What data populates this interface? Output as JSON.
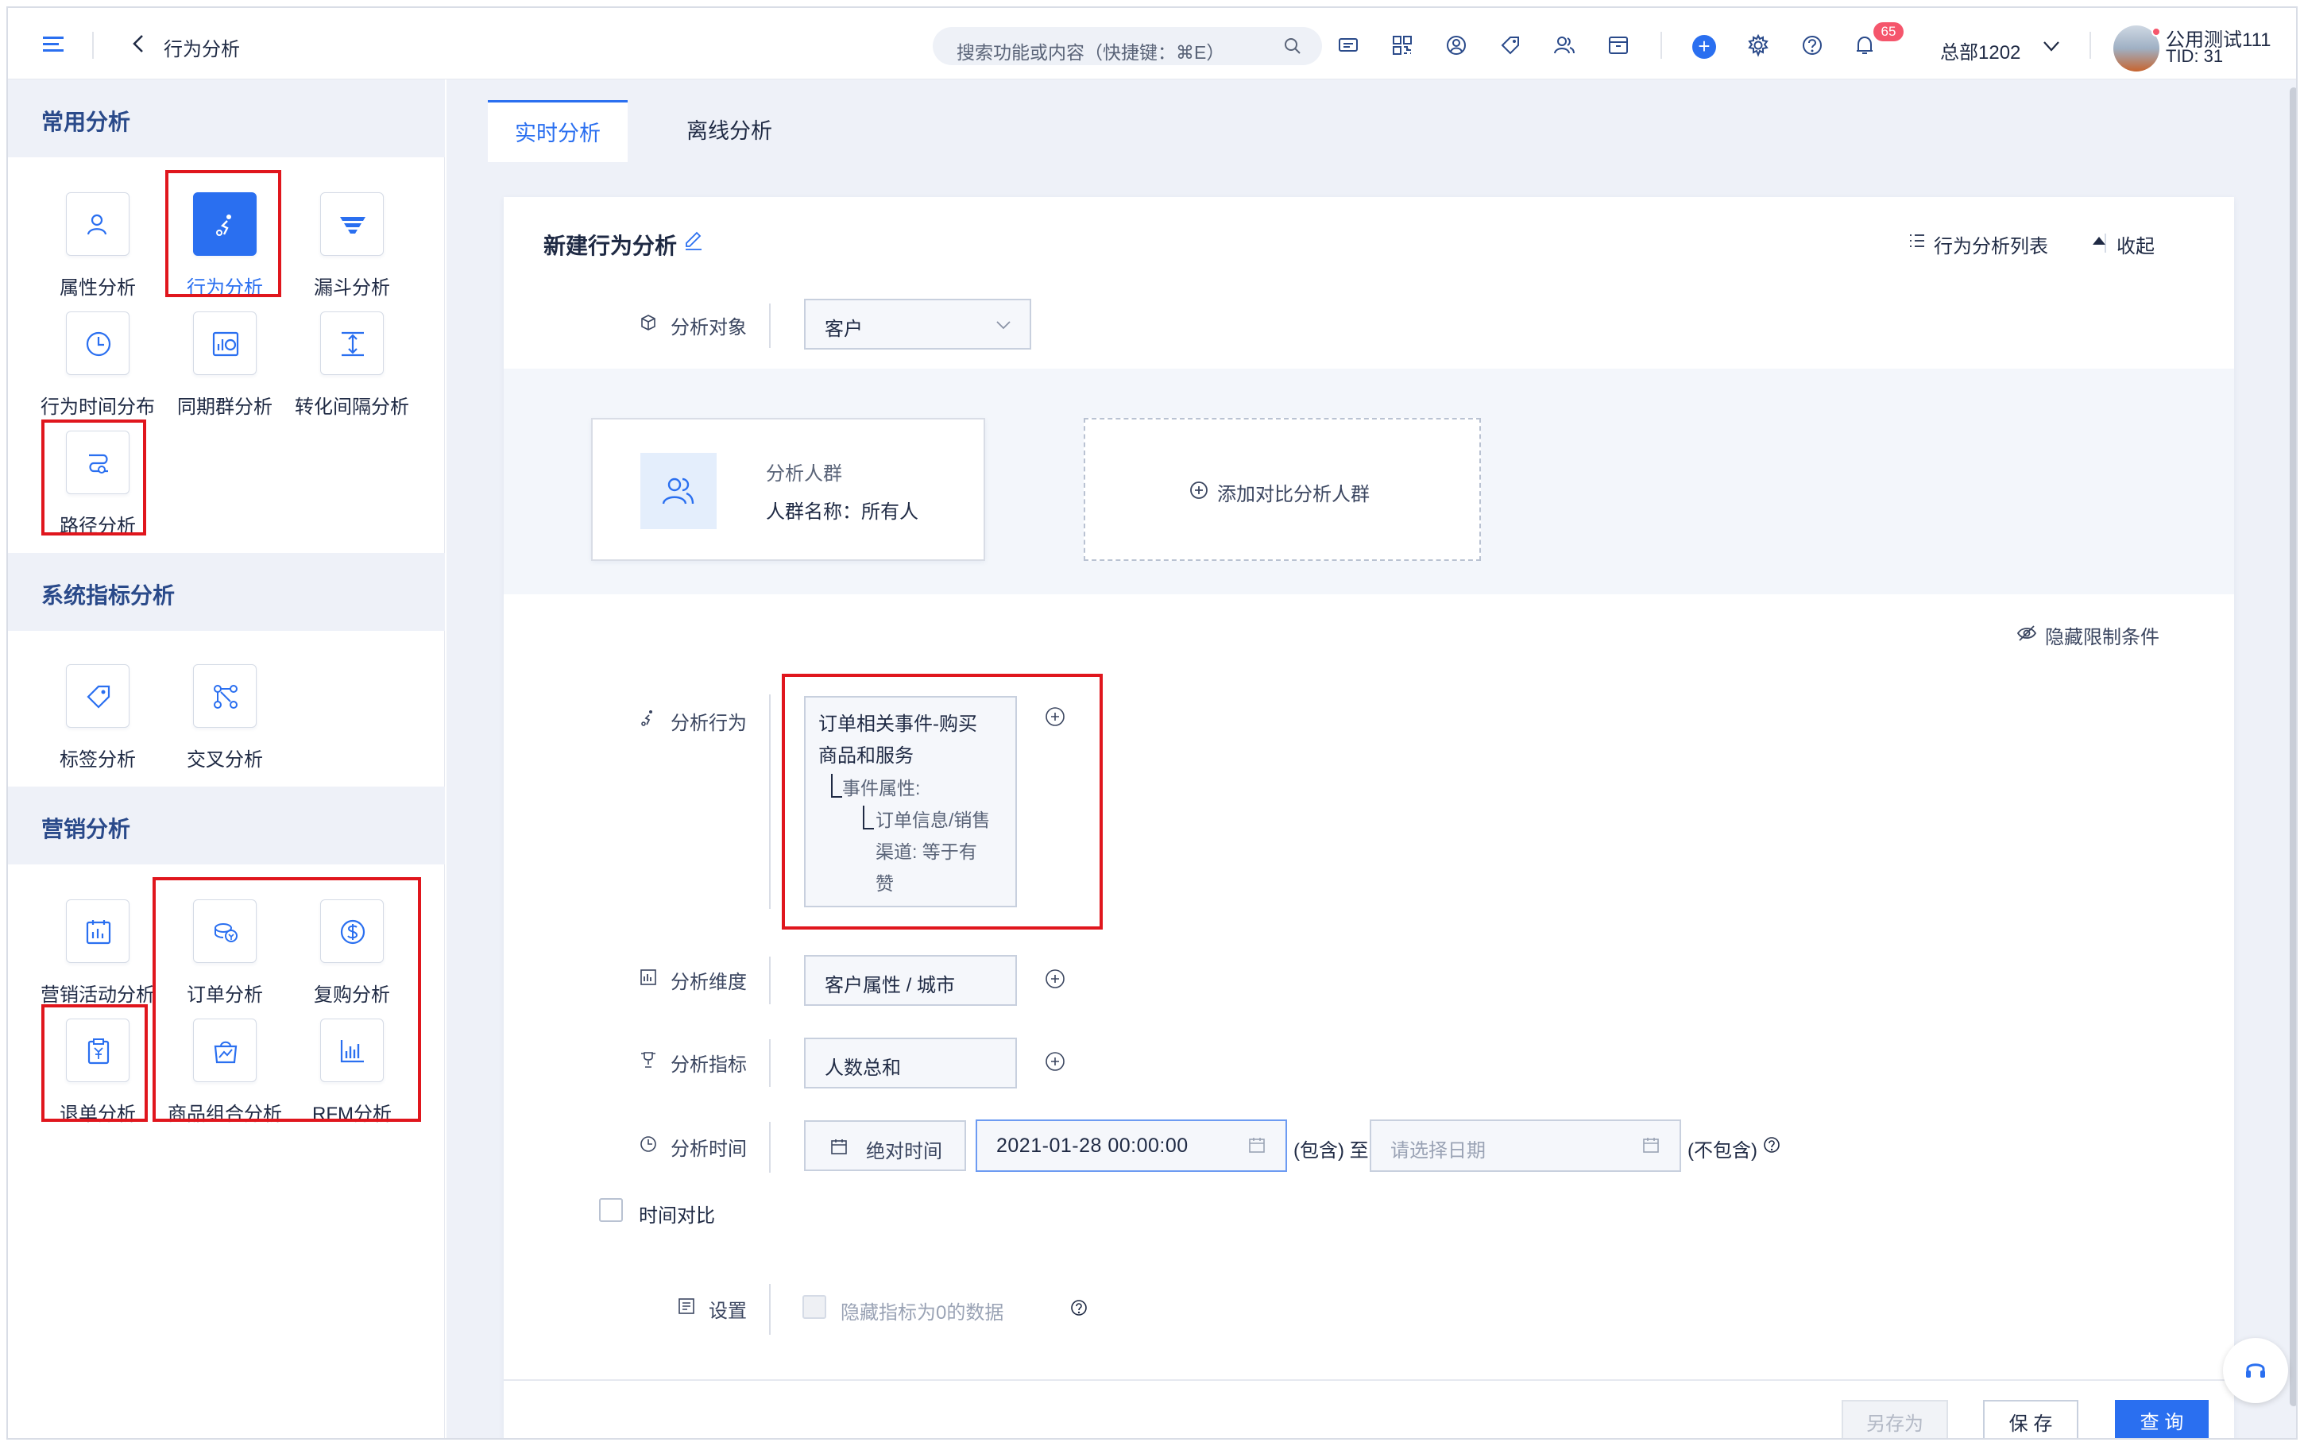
{
  "topbar": {
    "title": "行为分析",
    "search_placeholder": "搜索功能或内容（快捷键：⌘E）",
    "notification_count": "65",
    "org": "总部1202",
    "user_name": "公用测试111",
    "user_tid": "TID: 31"
  },
  "sidebar": {
    "sections": [
      {
        "title": "常用分析"
      },
      {
        "title": "系统指标分析"
      },
      {
        "title": "营销分析"
      }
    ],
    "tools": {
      "attr": "属性分析",
      "behavior": "行为分析",
      "funnel": "漏斗分析",
      "time_dist": "行为时间分布",
      "cohort": "同期群分析",
      "interval": "转化间隔分析",
      "path": "路径分析",
      "tag": "标签分析",
      "cross": "交叉分析",
      "campaign": "营销活动分析",
      "order": "订单分析",
      "repurchase": "复购分析",
      "refund": "退单分析",
      "bundle": "商品组合分析",
      "rfm": "RFM分析"
    }
  },
  "main": {
    "tabs": {
      "realtime": "实时分析",
      "offline": "离线分析"
    },
    "card": {
      "title": "新建行为分析",
      "list_link": "行为分析列表",
      "collapse": "收起"
    },
    "object": {
      "label": "分析对象",
      "value": "客户"
    },
    "crowd": {
      "title": "分析人群",
      "name": "人群名称：所有人",
      "add": "添加对比分析人群"
    },
    "hide_conditions": "隐藏限制条件",
    "behavior": {
      "label": "分析行为",
      "event_line1": "订单相关事件-购买",
      "event_line2": "商品和服务",
      "prop_line": "事件属性:",
      "cond_line1": "订单信息/销售",
      "cond_line2": "渠道: 等于有",
      "cond_line3": "赞"
    },
    "dimension": {
      "label": "分析维度",
      "value": "客户属性 / 城市"
    },
    "metric": {
      "label": "分析指标",
      "value": "人数总和"
    },
    "time": {
      "label": "分析时间",
      "mode": "绝对时间",
      "start": "2021-01-28 00:00:00",
      "include": "(包含) 至",
      "end_placeholder": "请选择日期",
      "exclude": "(不包含)"
    },
    "compare": "时间对比",
    "settings": {
      "label": "设置",
      "hide_zero": "隐藏指标为0的数据"
    },
    "buttons": {
      "save_as": "另存为",
      "save": "保 存",
      "query": "查 询"
    }
  },
  "colors": {
    "accent": "#2a6ff0",
    "highlight": "#e0161d",
    "sidebar_head": "#eef1f8"
  }
}
